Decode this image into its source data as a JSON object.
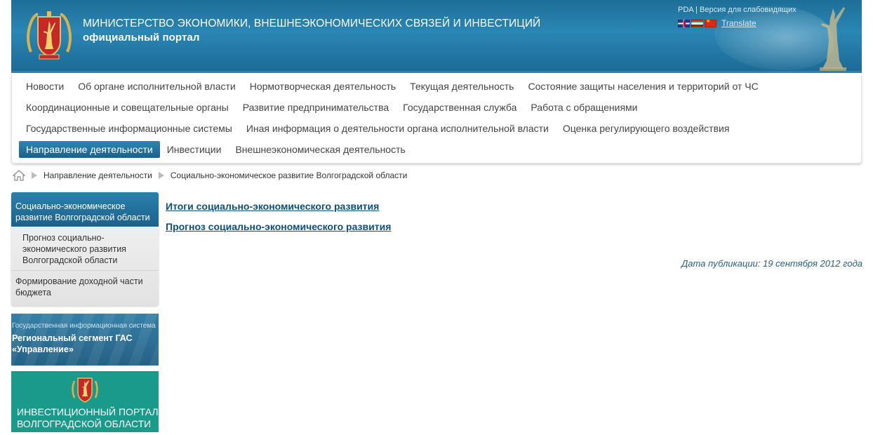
{
  "header": {
    "title_line1": "МИНИСТЕРСТВО ЭКОНОМИКИ, ВНЕШНЕЭКОНОМИЧЕСКИХ СВЯЗЕЙ И ИНВЕСТИЦИЙ",
    "title_line2": "официальный портал",
    "pda_label": "PDA",
    "separator": "|",
    "accessibility_label": "Версия для слабовидящих",
    "translate_label": "Translate",
    "flags": [
      "uk-flag-icon",
      "iran-flag-icon",
      "china-flag-icon"
    ]
  },
  "nav": {
    "row1": [
      "Новости",
      "Об органе исполнительной власти",
      "Нормотворческая деятельность",
      "Текущая деятельность",
      "Состояние защиты населения и территорий от ЧС"
    ],
    "row2": [
      "Координационные и совещательные органы",
      "Развитие предпринимательства",
      "Государственная служба",
      "Работа с обращениями"
    ],
    "row3": [
      "Государственные информационные системы",
      "Иная информация о деятельности органа исполнительной власти",
      "Оценка регулирующего воздействия"
    ],
    "row4": [
      "Направление деятельности",
      "Инвестиции",
      "Внешнеэкономическая деятельность"
    ],
    "active": "Направление деятельности"
  },
  "breadcrumb": {
    "home_icon": "home-icon",
    "items": [
      "Направление деятельности",
      "Социально-экономическое развитие Волгоградской области"
    ]
  },
  "sidebar": {
    "active_label": "Социально-экономическое развитие Волгоградской области",
    "sub_label": "Прогноз социально-экономического развития Волгоградской области",
    "item_label": "Формирование доходной части бюджета"
  },
  "banners": {
    "gas_small": "Государственная информационная система",
    "gas_title": "Региональный сегмент ГАС «Управление»",
    "invest_line1": "ИНВЕСТИЦИОННЫЙ ПОРТАЛ",
    "invest_line2": "ВОЛГОГРАДСКОЙ ОБЛАСТИ"
  },
  "content": {
    "links": [
      "Итоги социально-экономического развития",
      "Прогноз социально-экономического развития"
    ],
    "publication_date": "Дата публикации: 19 сентября 2012 года"
  },
  "colors": {
    "header_blue": "#1d6f98",
    "nav_active": "#1a618b",
    "link": "#0b4f7d",
    "invest_green": "#1a9a8a"
  }
}
